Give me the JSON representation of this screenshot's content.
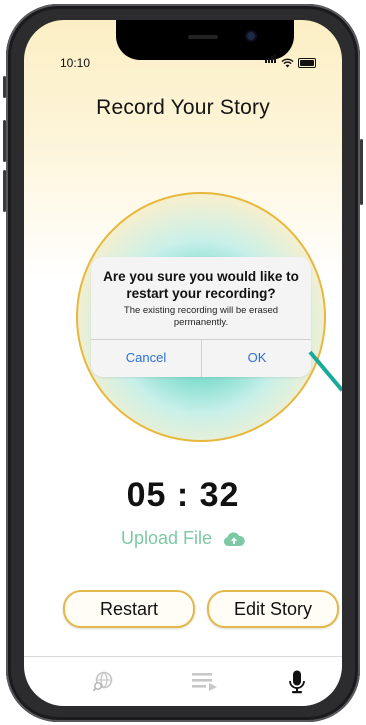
{
  "status_bar": {
    "time": "10:10"
  },
  "page": {
    "title": "Record Your Story"
  },
  "dialog": {
    "title": "Are you sure you would like to restart your recording?",
    "message": "The existing recording will be erased permanently.",
    "cancel_label": "Cancel",
    "ok_label": "OK"
  },
  "recorder": {
    "timer": "05 : 32",
    "upload_label": "Upload File"
  },
  "actions": {
    "restart_label": "Restart",
    "edit_label": "Edit Story"
  },
  "tabbar": {
    "items": [
      "globe-search-icon",
      "playlist-icon",
      "microphone-icon"
    ]
  },
  "colors": {
    "accent_gold": "#e7b83c",
    "teal": "#1aa99a",
    "upload_green": "#7cc9a4",
    "ios_blue": "#2b6fd6"
  }
}
